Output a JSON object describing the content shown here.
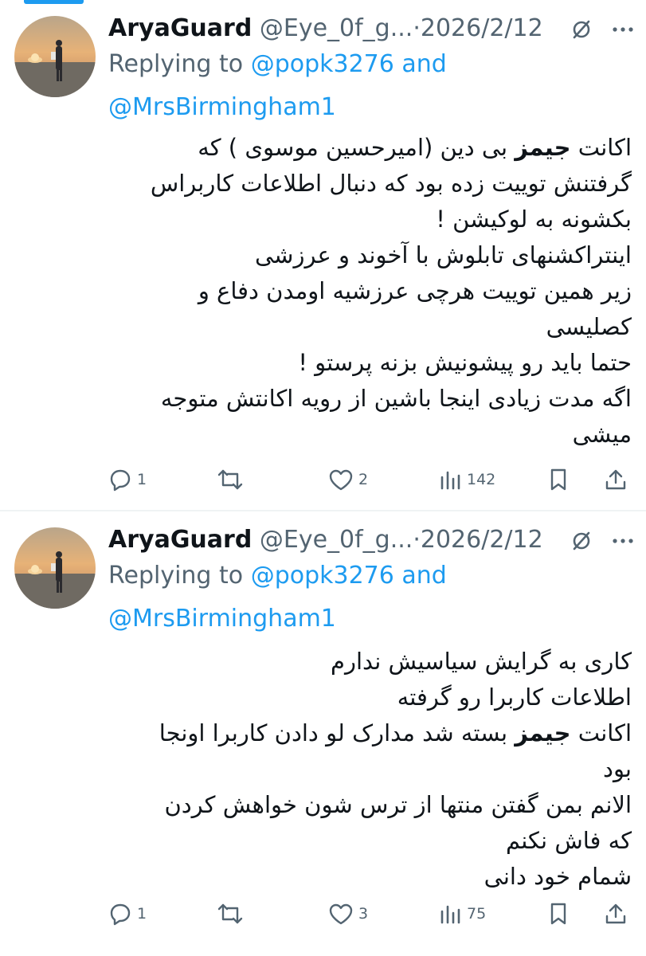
{
  "tweets": [
    {
      "name": "AryaGuard",
      "handle": "@Eye_0f_g...",
      "separator": "·",
      "date": "2026/2/12",
      "replying_prefix": "Replying to",
      "mention1": "@popk3276",
      "and": "and",
      "mention2": "@MrsBirmingham1",
      "body": [
        [
          "اکانت ",
          "جیمز",
          " بی دین (امیرحسین موسوی ) که"
        ],
        [
          "گرفتنش توییت زده بود که دنبال اطلاعات کاربراس",
          "",
          ""
        ],
        [
          "بکشونه به لوکیشن !",
          "",
          ""
        ],
        [
          "اینتراکشنهای تابلوش با آخوند و عرزشی",
          "",
          ""
        ],
        [
          "زیر همین توییت هرچی عرزشیه اومدن دفاع و",
          "",
          ""
        ],
        [
          "کصلیسی",
          "",
          ""
        ],
        [
          "حتما باید رو پیشونیش بزنه پرستو !",
          "",
          ""
        ],
        [
          "اگه مدت زیادی اینجا باشین از رویه اکانتش متوجه",
          "",
          ""
        ],
        [
          "میشی",
          "",
          ""
        ]
      ],
      "replies": "1",
      "retweets": "",
      "likes": "2",
      "views": "142"
    },
    {
      "name": "AryaGuard",
      "handle": "@Eye_0f_g...",
      "separator": "·",
      "date": "2026/2/12",
      "replying_prefix": "Replying to",
      "mention1": "@popk3276",
      "and": "and",
      "mention2": "@MrsBirmingham1",
      "body": [
        [
          "کاری به گرایش سیاسیش ندارم",
          "",
          ""
        ],
        [
          "اطلاعات کاربرا رو گرفته",
          "",
          ""
        ],
        [
          "اکانت ",
          "جیمز",
          " بسته شد مدارک لو دادن کاربرا اونجا"
        ],
        [
          "بود",
          "",
          ""
        ],
        [
          "الانم بمن گفتن منتها از ترس شون خواهش کردن",
          "",
          ""
        ],
        [
          "که فاش نکنم",
          "",
          ""
        ],
        [
          "شمام خود دانی",
          "",
          ""
        ]
      ],
      "replies": "1",
      "retweets": "",
      "likes": "3",
      "views": "75"
    }
  ],
  "colors": {
    "accent": "#1d9bf0",
    "secondary_text": "#536471",
    "divider": "#eff3f4"
  },
  "icons": [
    "grok-slash-icon",
    "more-icon",
    "reply-icon",
    "retweet-icon",
    "like-icon",
    "views-icon",
    "bookmark-icon",
    "share-icon"
  ]
}
